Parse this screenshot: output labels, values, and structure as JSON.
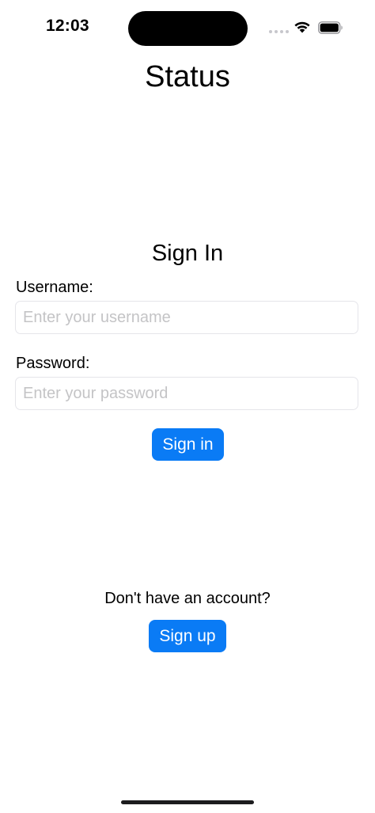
{
  "status_bar": {
    "time": "12:03",
    "icons": [
      "cellular-signal-icon",
      "wifi-icon",
      "battery-icon"
    ]
  },
  "app": {
    "title": "Status"
  },
  "sign_in": {
    "heading": "Sign In",
    "username_label": "Username:",
    "username_value": "",
    "username_placeholder": "Enter your username",
    "password_label": "Password:",
    "password_value": "",
    "password_placeholder": "Enter your password",
    "submit_label": "Sign in"
  },
  "sign_up": {
    "prompt": "Don't have an account?",
    "button_label": "Sign up"
  },
  "colors": {
    "accent": "#0a7bf5",
    "placeholder": "#c4c4c6",
    "field_border": "#e5e5ea",
    "background": "#ffffff",
    "text": "#000000"
  }
}
